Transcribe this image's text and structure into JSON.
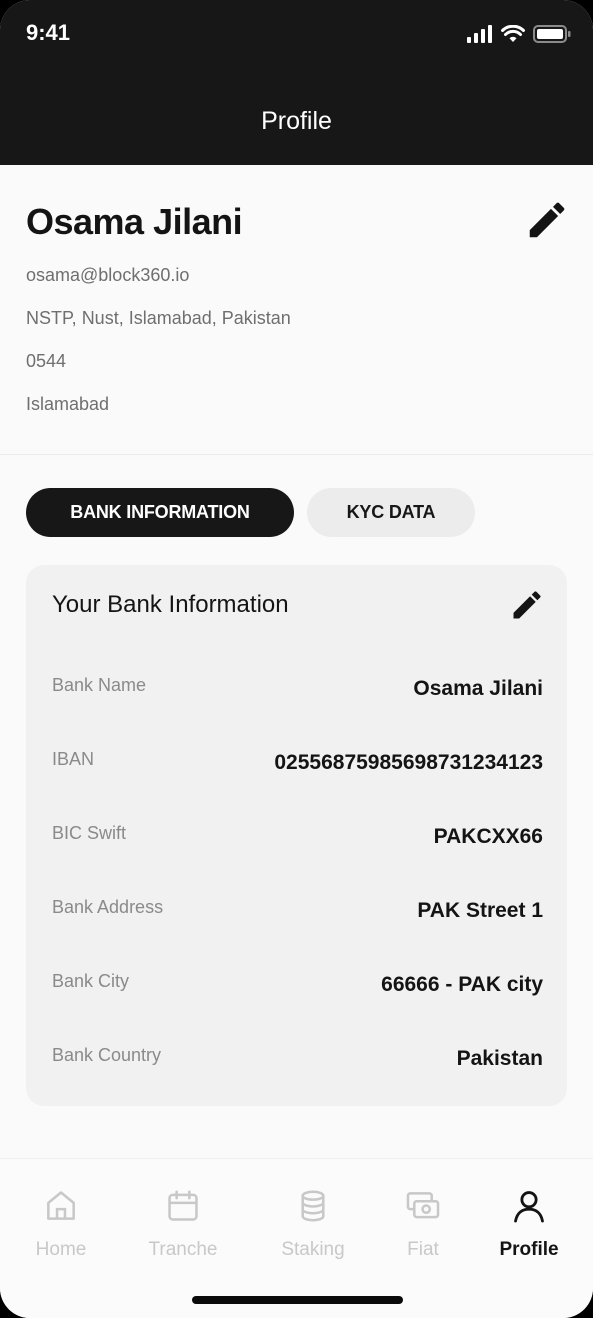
{
  "status_bar": {
    "time": "9:41"
  },
  "header": {
    "title": "Profile"
  },
  "profile": {
    "name": "Osama Jilani",
    "email": "osama@block360.io",
    "address": "NSTP, Nust, Islamabad, Pakistan",
    "phone": "0544",
    "city": "Islamabad"
  },
  "tabs": [
    {
      "label": "BANK INFORMATION",
      "active": true
    },
    {
      "label": "KYC DATA",
      "active": false
    }
  ],
  "bank_card": {
    "title": "Your Bank Information",
    "rows": [
      {
        "label": "Bank Name",
        "value": "Osama Jilani"
      },
      {
        "label": "IBAN",
        "value": "025568759856987312341​23"
      },
      {
        "label": "BIC Swift",
        "value": "PAKCXX66"
      },
      {
        "label": "Bank Address",
        "value": "PAK Street 1"
      },
      {
        "label": "Bank City",
        "value": "66666 - PAK city"
      },
      {
        "label": "Bank Country",
        "value": "Pakistan"
      }
    ]
  },
  "bottom_nav": [
    {
      "label": "Home",
      "icon": "home-icon",
      "active": false
    },
    {
      "label": "Tranche",
      "icon": "calendar-icon",
      "active": false
    },
    {
      "label": "Staking",
      "icon": "coins-stack-icon",
      "active": false
    },
    {
      "label": "Fiat",
      "icon": "cash-icon",
      "active": false
    },
    {
      "label": "Profile",
      "icon": "user-icon",
      "active": true
    }
  ],
  "colors": {
    "header_bg": "#171717",
    "accent": "#171717",
    "inactive_nav": "#c8c8c8"
  }
}
